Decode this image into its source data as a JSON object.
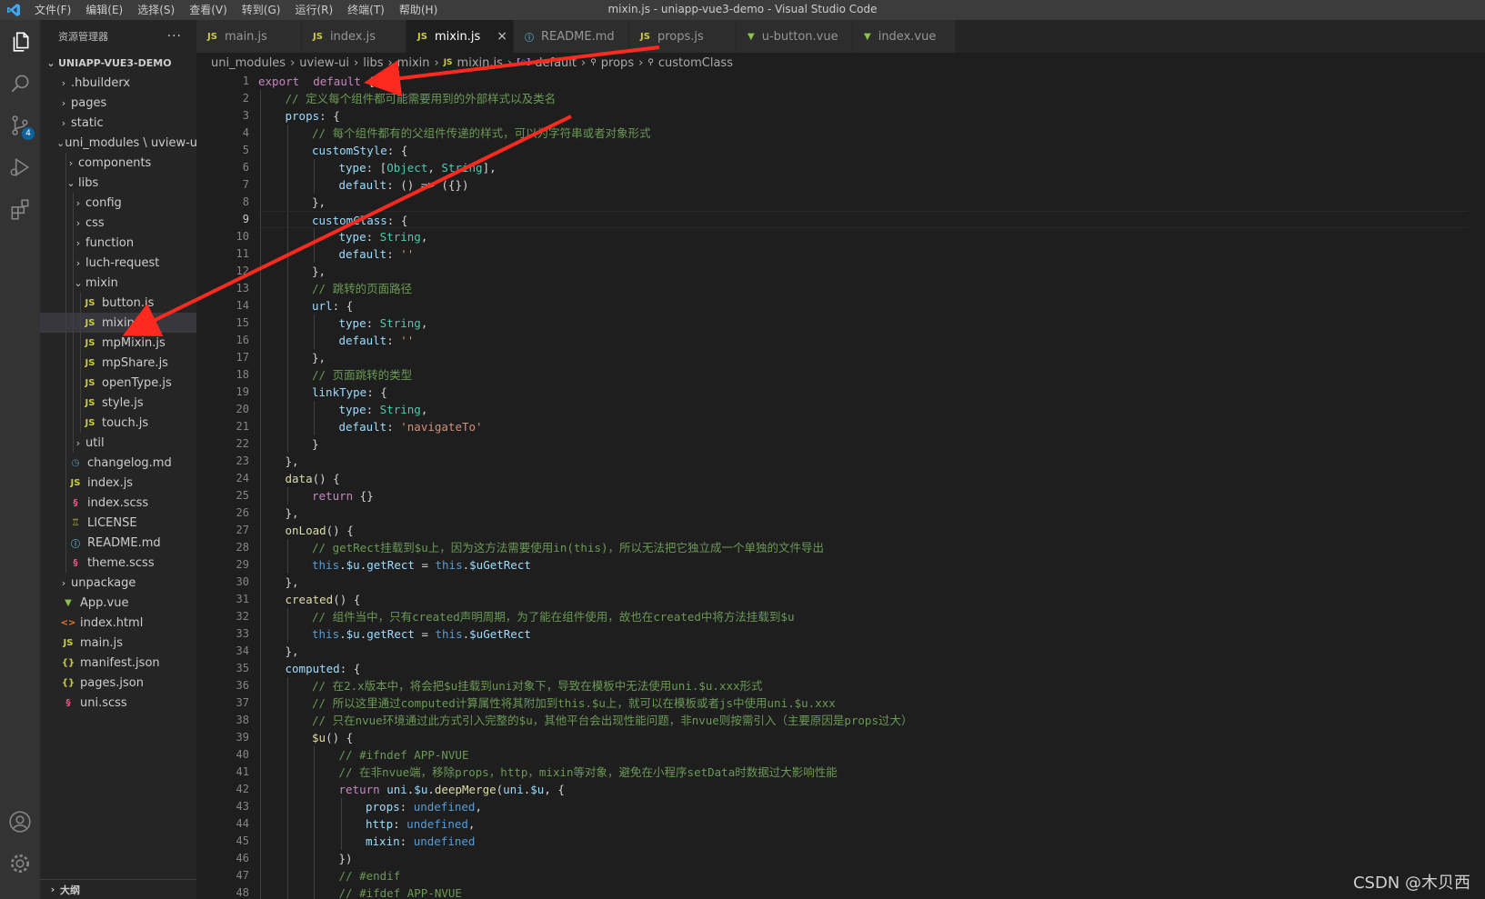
{
  "titlebar": {
    "menu": [
      "文件(F)",
      "编辑(E)",
      "选择(S)",
      "查看(V)",
      "转到(G)",
      "运行(R)",
      "终端(T)",
      "帮助(H)"
    ],
    "window_title": "mixin.js - uniapp-vue3-demo - Visual Studio Code"
  },
  "activitybar": {
    "scm_badge": "4"
  },
  "sidebar": {
    "title": "资源管理器",
    "more": "···",
    "outline": "大纲",
    "tree": [
      {
        "label": "UNIAPP-VUE3-DEMO",
        "depth": 0,
        "chevron": "open",
        "icon": "",
        "root": true
      },
      {
        "label": ".hbuilderx",
        "depth": 1,
        "chevron": "closed",
        "icon": ""
      },
      {
        "label": "pages",
        "depth": 1,
        "chevron": "closed",
        "icon": ""
      },
      {
        "label": "static",
        "depth": 1,
        "chevron": "closed",
        "icon": ""
      },
      {
        "label": "uni_modules \\ uview-ui",
        "depth": 1,
        "chevron": "open",
        "icon": ""
      },
      {
        "label": "components",
        "depth": 2,
        "chevron": "closed",
        "icon": ""
      },
      {
        "label": "libs",
        "depth": 2,
        "chevron": "open",
        "icon": ""
      },
      {
        "label": "config",
        "depth": 3,
        "chevron": "closed",
        "icon": ""
      },
      {
        "label": "css",
        "depth": 3,
        "chevron": "closed",
        "icon": ""
      },
      {
        "label": "function",
        "depth": 3,
        "chevron": "closed",
        "icon": ""
      },
      {
        "label": "luch-request",
        "depth": 3,
        "chevron": "closed",
        "icon": ""
      },
      {
        "label": "mixin",
        "depth": 3,
        "chevron": "open",
        "icon": ""
      },
      {
        "label": "button.js",
        "depth": 4,
        "chevron": "none",
        "icon": "js"
      },
      {
        "label": "mixin.js",
        "depth": 4,
        "chevron": "none",
        "icon": "js",
        "selected": true
      },
      {
        "label": "mpMixin.js",
        "depth": 4,
        "chevron": "none",
        "icon": "js"
      },
      {
        "label": "mpShare.js",
        "depth": 4,
        "chevron": "none",
        "icon": "js"
      },
      {
        "label": "openType.js",
        "depth": 4,
        "chevron": "none",
        "icon": "js"
      },
      {
        "label": "style.js",
        "depth": 4,
        "chevron": "none",
        "icon": "js"
      },
      {
        "label": "touch.js",
        "depth": 4,
        "chevron": "none",
        "icon": "js"
      },
      {
        "label": "util",
        "depth": 3,
        "chevron": "closed",
        "icon": ""
      },
      {
        "label": "changelog.md",
        "depth": 2,
        "chevron": "none",
        "icon": "clock"
      },
      {
        "label": "index.js",
        "depth": 2,
        "chevron": "none",
        "icon": "js"
      },
      {
        "label": "index.scss",
        "depth": 2,
        "chevron": "none",
        "icon": "scss"
      },
      {
        "label": "LICENSE",
        "depth": 2,
        "chevron": "none",
        "icon": "license"
      },
      {
        "label": "README.md",
        "depth": 2,
        "chevron": "none",
        "icon": "info"
      },
      {
        "label": "theme.scss",
        "depth": 2,
        "chevron": "none",
        "icon": "scss"
      },
      {
        "label": "unpackage",
        "depth": 1,
        "chevron": "closed",
        "icon": ""
      },
      {
        "label": "App.vue",
        "depth": 1,
        "chevron": "none",
        "icon": "vue"
      },
      {
        "label": "index.html",
        "depth": 1,
        "chevron": "none",
        "icon": "html"
      },
      {
        "label": "main.js",
        "depth": 1,
        "chevron": "none",
        "icon": "js"
      },
      {
        "label": "manifest.json",
        "depth": 1,
        "chevron": "none",
        "icon": "json"
      },
      {
        "label": "pages.json",
        "depth": 1,
        "chevron": "none",
        "icon": "json"
      },
      {
        "label": "uni.scss",
        "depth": 1,
        "chevron": "none",
        "icon": "scss"
      }
    ]
  },
  "tabs": [
    {
      "label": "main.js",
      "icon": "js"
    },
    {
      "label": "index.js",
      "icon": "js"
    },
    {
      "label": "mixin.js",
      "icon": "js",
      "active": true
    },
    {
      "label": "README.md",
      "icon": "info"
    },
    {
      "label": "props.js",
      "icon": "js"
    },
    {
      "label": "u-button.vue",
      "icon": "vue"
    },
    {
      "label": "index.vue",
      "icon": "vue"
    }
  ],
  "breadcrumb": [
    "uni_modules",
    "uview-ui",
    "libs",
    "mixin",
    "mixin.js",
    "default",
    "props",
    "customClass"
  ],
  "editor": {
    "current_line": 9,
    "lines": [
      {
        "n": "1",
        "i": 0,
        "t": [
          [
            "kw",
            "export"
          ],
          [
            "p",
            "  "
          ],
          [
            "kw",
            "default"
          ],
          [
            "p",
            " {"
          ]
        ]
      },
      {
        "n": "2",
        "i": 1,
        "t": [
          [
            "cm",
            "// 定义每个组件都可能需要用到的外部样式以及类名"
          ]
        ]
      },
      {
        "n": "3",
        "i": 1,
        "t": [
          [
            "prop",
            "props"
          ],
          [
            "p",
            ": {"
          ]
        ]
      },
      {
        "n": "4",
        "i": 2,
        "t": [
          [
            "cm",
            "// 每个组件都有的父组件传递的样式，可以为字符串或者对象形式"
          ]
        ]
      },
      {
        "n": "5",
        "i": 2,
        "t": [
          [
            "prop",
            "customStyle"
          ],
          [
            "p",
            ": {"
          ]
        ]
      },
      {
        "n": "6",
        "i": 3,
        "t": [
          [
            "prop",
            "type"
          ],
          [
            "p",
            ": ["
          ],
          [
            "type",
            "Object"
          ],
          [
            "p",
            ", "
          ],
          [
            "type",
            "String"
          ],
          [
            "p",
            "],"
          ]
        ]
      },
      {
        "n": "7",
        "i": 3,
        "t": [
          [
            "prop",
            "default"
          ],
          [
            "p",
            ": () => ({})"
          ]
        ]
      },
      {
        "n": "8",
        "i": 2,
        "t": [
          [
            "p",
            "},"
          ]
        ]
      },
      {
        "n": "9",
        "i": 2,
        "t": [
          [
            "prop",
            "customClass"
          ],
          [
            "p",
            ": {"
          ]
        ]
      },
      {
        "n": "10",
        "i": 3,
        "t": [
          [
            "prop",
            "type"
          ],
          [
            "p",
            ": "
          ],
          [
            "type",
            "String"
          ],
          [
            "p",
            ","
          ]
        ]
      },
      {
        "n": "11",
        "i": 3,
        "t": [
          [
            "prop",
            "default"
          ],
          [
            "p",
            ": "
          ],
          [
            "str",
            "''"
          ]
        ]
      },
      {
        "n": "12",
        "i": 2,
        "t": [
          [
            "p",
            "},"
          ]
        ]
      },
      {
        "n": "13",
        "i": 2,
        "t": [
          [
            "cm",
            "// 跳转的页面路径"
          ]
        ]
      },
      {
        "n": "14",
        "i": 2,
        "t": [
          [
            "prop",
            "url"
          ],
          [
            "p",
            ": {"
          ]
        ]
      },
      {
        "n": "15",
        "i": 3,
        "t": [
          [
            "prop",
            "type"
          ],
          [
            "p",
            ": "
          ],
          [
            "type",
            "String"
          ],
          [
            "p",
            ","
          ]
        ]
      },
      {
        "n": "16",
        "i": 3,
        "t": [
          [
            "prop",
            "default"
          ],
          [
            "p",
            ": "
          ],
          [
            "str",
            "''"
          ]
        ]
      },
      {
        "n": "17",
        "i": 2,
        "t": [
          [
            "p",
            "},"
          ]
        ]
      },
      {
        "n": "18",
        "i": 2,
        "t": [
          [
            "cm",
            "// 页面跳转的类型"
          ]
        ]
      },
      {
        "n": "19",
        "i": 2,
        "t": [
          [
            "prop",
            "linkType"
          ],
          [
            "p",
            ": {"
          ]
        ]
      },
      {
        "n": "20",
        "i": 3,
        "t": [
          [
            "prop",
            "type"
          ],
          [
            "p",
            ": "
          ],
          [
            "type",
            "String"
          ],
          [
            "p",
            ","
          ]
        ]
      },
      {
        "n": "21",
        "i": 3,
        "t": [
          [
            "prop",
            "default"
          ],
          [
            "p",
            ": "
          ],
          [
            "str",
            "'navigateTo'"
          ]
        ]
      },
      {
        "n": "22",
        "i": 2,
        "t": [
          [
            "p",
            "}"
          ]
        ]
      },
      {
        "n": "23",
        "i": 1,
        "t": [
          [
            "p",
            "},"
          ]
        ]
      },
      {
        "n": "24",
        "i": 1,
        "t": [
          [
            "fn",
            "data"
          ],
          [
            "p",
            "() {"
          ]
        ]
      },
      {
        "n": "25",
        "i": 2,
        "t": [
          [
            "kw",
            "return"
          ],
          [
            "p",
            " {}"
          ]
        ]
      },
      {
        "n": "26",
        "i": 1,
        "t": [
          [
            "p",
            "},"
          ]
        ]
      },
      {
        "n": "27",
        "i": 1,
        "t": [
          [
            "fn",
            "onLoad"
          ],
          [
            "p",
            "() {"
          ]
        ]
      },
      {
        "n": "28",
        "i": 2,
        "t": [
          [
            "cm",
            "// getRect挂载到$u上，因为这方法需要使用in(this)，所以无法把它独立成一个单独的文件导出"
          ]
        ]
      },
      {
        "n": "29",
        "i": 2,
        "t": [
          [
            "kw2",
            "this"
          ],
          [
            "p",
            "."
          ],
          [
            "prop",
            "$u"
          ],
          [
            "p",
            "."
          ],
          [
            "prop",
            "getRect"
          ],
          [
            "p",
            " = "
          ],
          [
            "kw2",
            "this"
          ],
          [
            "p",
            "."
          ],
          [
            "prop",
            "$uGetRect"
          ]
        ]
      },
      {
        "n": "30",
        "i": 1,
        "t": [
          [
            "p",
            "},"
          ]
        ]
      },
      {
        "n": "31",
        "i": 1,
        "t": [
          [
            "fn",
            "created"
          ],
          [
            "p",
            "() {"
          ]
        ]
      },
      {
        "n": "32",
        "i": 2,
        "t": [
          [
            "cm",
            "// 组件当中，只有created声明周期，为了能在组件使用，故也在created中将方法挂载到$u"
          ]
        ]
      },
      {
        "n": "33",
        "i": 2,
        "t": [
          [
            "kw2",
            "this"
          ],
          [
            "p",
            "."
          ],
          [
            "prop",
            "$u"
          ],
          [
            "p",
            "."
          ],
          [
            "prop",
            "getRect"
          ],
          [
            "p",
            " = "
          ],
          [
            "kw2",
            "this"
          ],
          [
            "p",
            "."
          ],
          [
            "prop",
            "$uGetRect"
          ]
        ]
      },
      {
        "n": "34",
        "i": 1,
        "t": [
          [
            "p",
            "},"
          ]
        ]
      },
      {
        "n": "35",
        "i": 1,
        "t": [
          [
            "prop",
            "computed"
          ],
          [
            "p",
            ": {"
          ]
        ]
      },
      {
        "n": "36",
        "i": 2,
        "t": [
          [
            "cm",
            "// 在2.x版本中，将会把$u挂载到uni对象下，导致在模板中无法使用uni.$u.xxx形式"
          ]
        ]
      },
      {
        "n": "37",
        "i": 2,
        "t": [
          [
            "cm",
            "// 所以这里通过computed计算属性将其附加到this.$u上，就可以在模板或者js中使用uni.$u.xxx"
          ]
        ]
      },
      {
        "n": "38",
        "i": 2,
        "t": [
          [
            "cm",
            "// 只在nvue环境通过此方式引入完整的$u，其他平台会出现性能问题，非nvue则按需引入（主要原因是props过大）"
          ]
        ]
      },
      {
        "n": "39",
        "i": 2,
        "t": [
          [
            "fn",
            "$u"
          ],
          [
            "p",
            "() {"
          ]
        ]
      },
      {
        "n": "40",
        "i": 3,
        "t": [
          [
            "cm",
            "// #ifndef APP-NVUE"
          ]
        ]
      },
      {
        "n": "41",
        "i": 3,
        "t": [
          [
            "cm",
            "// 在非nvue端，移除props，http，mixin等对象，避免在小程序setData时数据过大影响性能"
          ]
        ]
      },
      {
        "n": "42",
        "i": 3,
        "t": [
          [
            "kw",
            "return"
          ],
          [
            "p",
            " "
          ],
          [
            "prop",
            "uni"
          ],
          [
            "p",
            "."
          ],
          [
            "prop",
            "$u"
          ],
          [
            "p",
            "."
          ],
          [
            "fn",
            "deepMerge"
          ],
          [
            "p",
            "("
          ],
          [
            "prop",
            "uni"
          ],
          [
            "p",
            "."
          ],
          [
            "prop",
            "$u"
          ],
          [
            "p",
            ", {"
          ]
        ]
      },
      {
        "n": "43",
        "i": 4,
        "t": [
          [
            "prop",
            "props"
          ],
          [
            "p",
            ": "
          ],
          [
            "kw2",
            "undefined"
          ],
          [
            "p",
            ","
          ]
        ]
      },
      {
        "n": "44",
        "i": 4,
        "t": [
          [
            "prop",
            "http"
          ],
          [
            "p",
            ": "
          ],
          [
            "kw2",
            "undefined"
          ],
          [
            "p",
            ","
          ]
        ]
      },
      {
        "n": "45",
        "i": 4,
        "t": [
          [
            "prop",
            "mixin"
          ],
          [
            "p",
            ": "
          ],
          [
            "kw2",
            "undefined"
          ]
        ]
      },
      {
        "n": "46",
        "i": 3,
        "t": [
          [
            "p",
            "})"
          ]
        ]
      },
      {
        "n": "47",
        "i": 3,
        "t": [
          [
            "cm",
            "// #endif"
          ]
        ]
      },
      {
        "n": "48",
        "i": 3,
        "t": [
          [
            "cm",
            "// #ifdef APP-NVUE"
          ]
        ]
      }
    ]
  },
  "watermark": "CSDN @木贝西",
  "colors": {
    "arrow": "#ff2a1f",
    "js": "#cbcb41",
    "vue": "#8dc149",
    "scss": "#f55385",
    "info": "#519aba",
    "json": "#cbcb41",
    "html": "#e37933"
  }
}
